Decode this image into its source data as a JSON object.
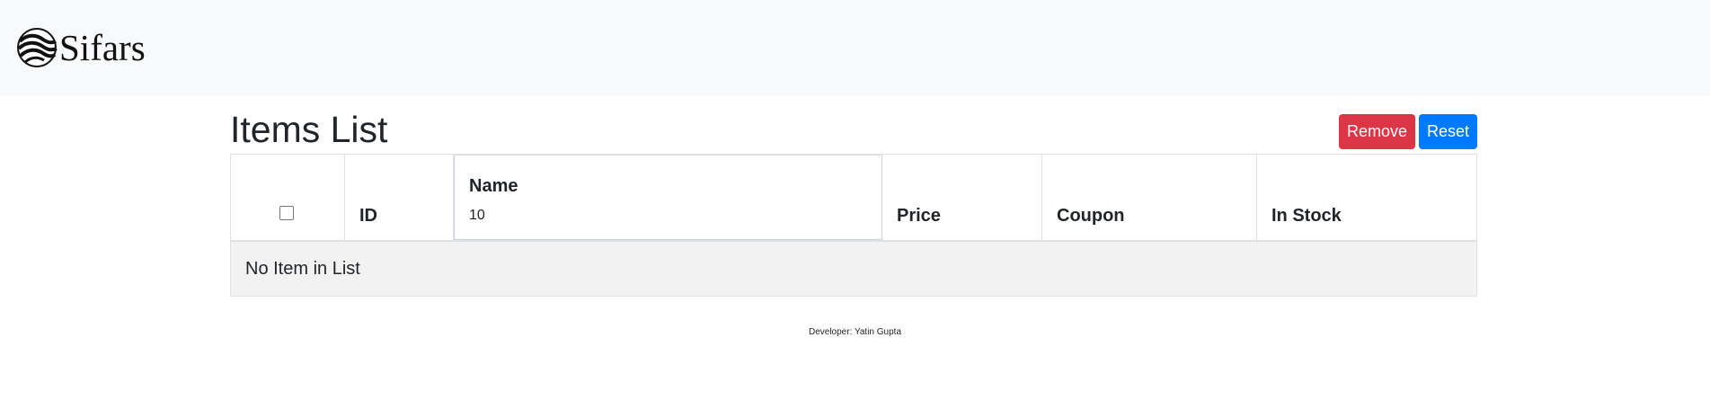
{
  "navbar": {
    "brand_text": "Sifars",
    "logo_icon": "sifars-wave-logo"
  },
  "main": {
    "title": "Items List",
    "buttons": {
      "remove_label": "Remove",
      "reset_label": "Reset"
    },
    "colors": {
      "remove": "#dc3545",
      "reset": "#007bff",
      "navbar_bg": "#f8f9fa",
      "empty_row_bg": "#f2f2f2"
    },
    "table": {
      "columns": {
        "select": "",
        "id": "ID",
        "name": "Name",
        "price": "Price",
        "coupon": "Coupon",
        "in_stock": "In Stock"
      },
      "name_filter_value": "10",
      "select_all_checked": false,
      "empty_message": "No Item in List"
    }
  },
  "footer": {
    "text": "Developer: Yatin Gupta"
  }
}
